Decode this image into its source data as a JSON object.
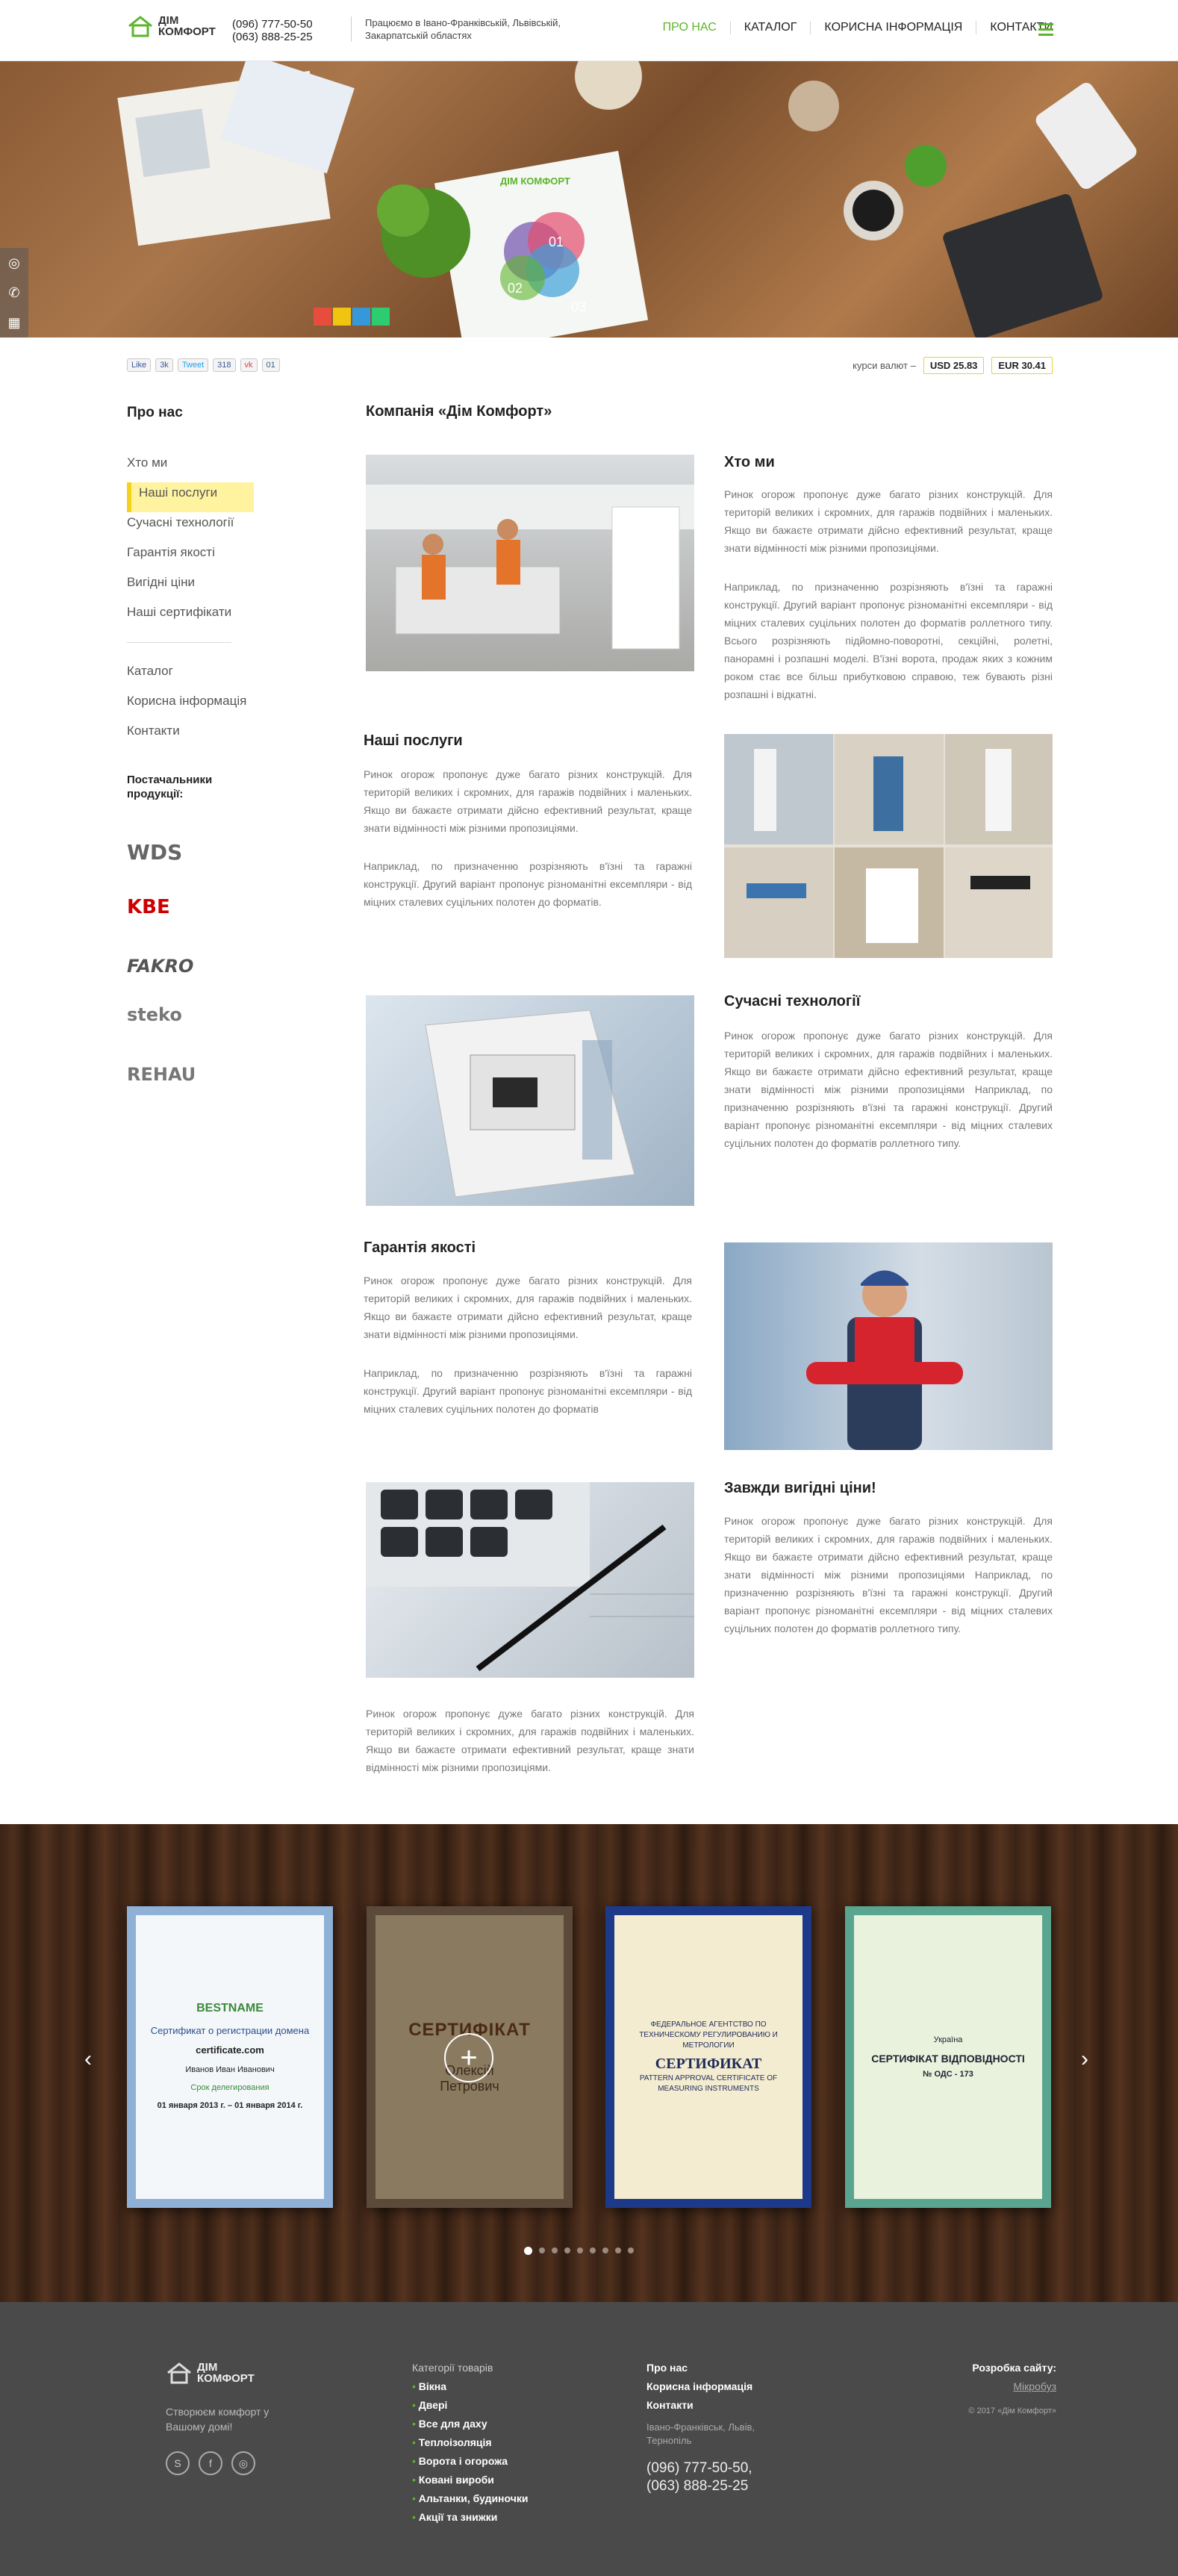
{
  "header": {
    "logo_line1": "ДІМ",
    "logo_line2": "КОМФОРТ",
    "phone1": "(096) 777-50-50",
    "phone2": "(063) 888-25-25",
    "region": "Працюємо в Івано-Франківській, Львівській, Закарпатській областях",
    "nav": [
      "ПРО НАС",
      "КАТАЛОГ",
      "КОРИСНА ІНФОРМАЦІЯ",
      "КОНТАКТИ"
    ],
    "accent_color": "#5db42c"
  },
  "hero": {
    "brochure_logo": "ДІМ КОМФОРТ",
    "chart_labels": [
      "01",
      "02",
      "03"
    ]
  },
  "share": {
    "like": "Like",
    "like_count": "3k",
    "tweet": "Tweet",
    "tweet_count": "318",
    "vk": "vk",
    "vk_count": "01"
  },
  "rates": {
    "label": "курси валют –",
    "usd": "USD 25.83",
    "eur": "EUR 30.41"
  },
  "sidebar": {
    "title": "Про нас",
    "items": [
      "Хто ми",
      "Наші послуги",
      "Сучасні технології",
      "Гарантія якості",
      "Вигідні ціни",
      "Наші сертифікати"
    ],
    "items2": [
      "Каталог",
      "Корисна інформація",
      "Контакти"
    ],
    "suppliers_title": "Постачальники продукції:",
    "suppliers": [
      "WDS",
      "KBE",
      "FAKRO",
      "steko",
      "REHAU"
    ]
  },
  "content": {
    "title": "Компанія «Дім Комфорт»",
    "sections": [
      {
        "title": "Хто ми",
        "p1": "Ринок огорож пропонує дуже багато різних конструкцій. Для територій великих і скромних, для гаражів подвійних і маленьких. Якщо ви бажаєте отримати дійсно ефективний результат, краще знати відмінності між різними пропозиціями.",
        "p2": "Наприклад, по призначенню розрізняють в'їзні та гаражні конструкції. Другий варіант пропонує різноманітні ексемпляри - від міцних сталевих суцільних полотен до форматів роллетного типу. Всього розрізняють підйомно-поворотні, секційні, ролетні, панорамні і розпашні моделі. В'їзні ворота, продаж яких з кожним роком стає все більш прибутковою справою, теж бувають різні розпашні і відкатні."
      },
      {
        "title": "Наші послуги",
        "p1": "Ринок огорож пропонує дуже багато різних конструкцій. Для територій великих і скромних, для гаражів подвійних і маленьких. Якщо ви бажаєте отримати дійсно ефективний результат, краще знати відмінності між різними пропозиціями.",
        "p2": "Наприклад, по призначенню розрізняють в'їзні та гаражні конструкції. Другий варіант пропонує різноманітні ексемпляри - від міцних сталевих суцільних полотен до форматів."
      },
      {
        "title": "Сучасні технології",
        "p1": "Ринок огорож пропонує дуже багато різних конструкцій. Для територій великих і скромних, для гаражів подвійних і маленьких. Якщо ви бажаєте отримати дійсно ефективний результат, краще знати відмінності між різними пропозиціями Наприклад, по призначенню розрізняють в'їзні та гаражні конструкції. Другий варіант пропонує різноманітні ексемпляри - від міцних сталевих суцільних полотен до форматів роллетного типу."
      },
      {
        "title": "Гарантія якості",
        "p1": "Ринок огорож пропонує дуже багато різних конструкцій. Для територій великих і скромних, для гаражів подвійних і маленьких. Якщо ви бажаєте отримати дійсно ефективний результат, краще знати відмінності між різними пропозиціями.",
        "p2": "Наприклад, по призначенню розрізняють в'їзні та гаражні конструкції. Другий варіант пропонує різноманітні ексемпляри - від міцних сталевих суцільних полотен до форматів"
      },
      {
        "title": "Завжди вигідні ціни!",
        "p1": "Ринок огорож пропонує дуже багато різних конструкцій. Для територій великих і скромних, для гаражів подвійних і маленьких. Якщо ви бажаєте отримати дійсно ефективний результат, краще знати відмінності між різними пропозиціями Наприклад, по призначенню розрізняють в'їзні та гаражні конструкції. Другий варіант пропонує різноманітні ексемпляри - від міцних сталевих суцільних полотен до форматів роллетного типу."
      }
    ],
    "bottom_para": "Ринок огорож пропонує дуже багато різних конструкцій. Для територій великих і скромних, для гаражів подвійних і маленьких. Якщо ви бажаєте отримати ефективний результат, краще знати відмінності між різними пропозиціями."
  },
  "certificates": [
    {
      "title": "BESTNAME",
      "line1": "Сертификат о регистрации домена",
      "line2": "certificate.com",
      "line3": "Иванов Иван Иванович",
      "line4": "Срок делегирования",
      "line5": "01 января 2013 г. – 01 января 2014 г."
    },
    {
      "title": "СЕРТИФІКАТ",
      "line1": "Олексій",
      "line2": "Петрович"
    },
    {
      "title": "СЕРТИФИКАТ",
      "line1": "ФЕДЕРАЛЬНОЕ АГЕНТСТВО ПО ТЕХНИЧЕСКОМУ РЕГУЛИРОВАНИЮ И МЕТРОЛОГИИ",
      "line2": "PATTERN APPROVAL CERTIFICATE OF MEASURING INSTRUMENTS"
    },
    {
      "title": "СЕРТИФІКАТ ВІДПОВІДНОСТІ",
      "line1": "Україна",
      "line2": "№ ОДС - 173"
    }
  ],
  "footer": {
    "logo_line1": "ДІМ",
    "logo_line2": "КОМФОРТ",
    "tagline": "Створюєм комфорт у Вашому домі!",
    "categories_title": "Категорії товарів",
    "categories": [
      "Вікна",
      "Двері",
      "Все для даху",
      "Теплоізоляція",
      "Ворота і огорожа",
      "Ковані вироби",
      "Альтанки, будиночки",
      "Акції та знижки"
    ],
    "links": [
      "Про нас",
      "Корисна інформація",
      "Контакти"
    ],
    "cities": "Івано-Франківськ, Львів, Тернопіль",
    "phone1": "(096) 777-50-50,",
    "phone2": "(063) 888-25-25",
    "dev_title": "Розробка сайту:",
    "dev_name": "Мікробуз",
    "copyright": "© 2017 «Дім Комфорт»"
  }
}
